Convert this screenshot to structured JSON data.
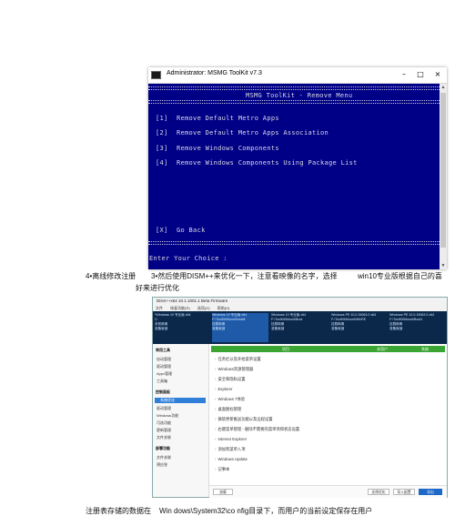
{
  "console_window": {
    "title": "Administrator:  MSMG ToolKit v7.3",
    "buttons": {
      "minimize": "–",
      "maximize": "□",
      "close": "×"
    },
    "separator": "================================================================================================",
    "header": "MSMG ToolKit - Remove Menu",
    "menu": [
      {
        "key": "[1]",
        "label": "Remove Default Metro Apps"
      },
      {
        "key": "[2]",
        "label": "Remove Default Metro Apps Association"
      },
      {
        "key": "[3]",
        "label": "Remove Windows Components"
      },
      {
        "key": "[4]",
        "label": "Remove Windows Components Using Package List"
      }
    ],
    "back": {
      "key": "[X]",
      "label": "Go Back"
    },
    "prompt": "Enter Your Choice :"
  },
  "captions": {
    "left": "4•离线修改注册",
    "middle_line1": "3•然后使用DISM++来优化一下，注意看映像的名字，选择",
    "middle_line2": "好来进行优化",
    "right": "win10专业版根据自己的喜",
    "bottom_left": "注册表存储的数据在",
    "bottom_right": "Win dows\\System32\\co nfig目录下，而用户的当前设定保存在用户"
  },
  "dism_window": {
    "title": "Dism++x64 10.1.1001.1 Beta Firmware",
    "menu": [
      "文件",
      "恢复功能(R)",
      "选项(O)",
      "帮助(H)"
    ],
    "images": [
      {
        "line1": "*Windows 10 专业版 x64",
        "line2": "C:",
        "line3": "未知映像",
        "line4": "准备就绪"
      },
      {
        "line1": "Windows 10 专业版 x64",
        "line2": "F:\\ToolKit\\Mount\\Install",
        "line3": "挂载映像",
        "line4": "准备就绪"
      },
      {
        "line1": "Windows 10 专业版 x64",
        "line2": "F:\\ToolKit\\Mount\\Boot",
        "line3": "挂载映像",
        "line4": "准备就绪"
      },
      {
        "line1": "Windows PE 10.0.15063.0 x64",
        "line2": "F:\\ToolKit\\Mount\\WinRE",
        "line3": "挂载映像",
        "line4": "准备就绪"
      },
      {
        "line1": "Windows PE 10.0.15063.0 x64",
        "line2": "F:\\ToolKit\\Mount\\Boot1",
        "line3": "挂载映像",
        "line4": "准备就绪"
      },
      {
        "line1": "Windows PE 10.0.15063.0 x64",
        "line2": "F:\\ToolKit\\Mount\\Boot2",
        "line3": "挂载映像",
        "line4": "准备就绪"
      }
    ],
    "sidebar": [
      {
        "label": "常用工具",
        "kind": "head"
      },
      {
        "label": "启动管理",
        "kind": "item"
      },
      {
        "label": "驱动管理",
        "kind": "item"
      },
      {
        "label": "Appx管理",
        "kind": "item"
      },
      {
        "label": "工具箱",
        "kind": "item"
      },
      {
        "label": "控制面板",
        "kind": "head"
      },
      {
        "label": "系统优化",
        "kind": "active"
      },
      {
        "label": "驱动管理",
        "kind": "item"
      },
      {
        "label": "Windows功能",
        "kind": "item"
      },
      {
        "label": "可选功能",
        "kind": "item"
      },
      {
        "label": "更新管理",
        "kind": "item"
      },
      {
        "label": "文件关联",
        "kind": "item"
      },
      {
        "label": "部署功能",
        "kind": "head"
      },
      {
        "label": "文件关联",
        "kind": "item"
      },
      {
        "label": "预应答",
        "kind": "item"
      }
    ],
    "columns": [
      "项目",
      "本用户",
      "系统"
    ],
    "items": [
      "任务栏以及开始菜单设置",
      "Windows资源管理器",
      "安全和隐私设置",
      "Explorer",
      "Windows 7体验",
      "桌面图标管理",
      "微软更新推送功能以及远程设置",
      "右键菜单管理 - 删除不需要的菜单项和状态设置",
      "Internet Explorer",
      "添加到菜单入项",
      "Windows Update",
      "记事本"
    ],
    "footer": {
      "left": "加载",
      "restore": "还原优化",
      "export": "导入配置",
      "apply": "导出"
    }
  },
  "colors": {
    "console_bg": "#000086",
    "console_text": "#d8d8e8",
    "dism_image_bar": "#0b2749",
    "dism_header_green": "#3aa533",
    "dism_accent": "#2f7fd8"
  }
}
